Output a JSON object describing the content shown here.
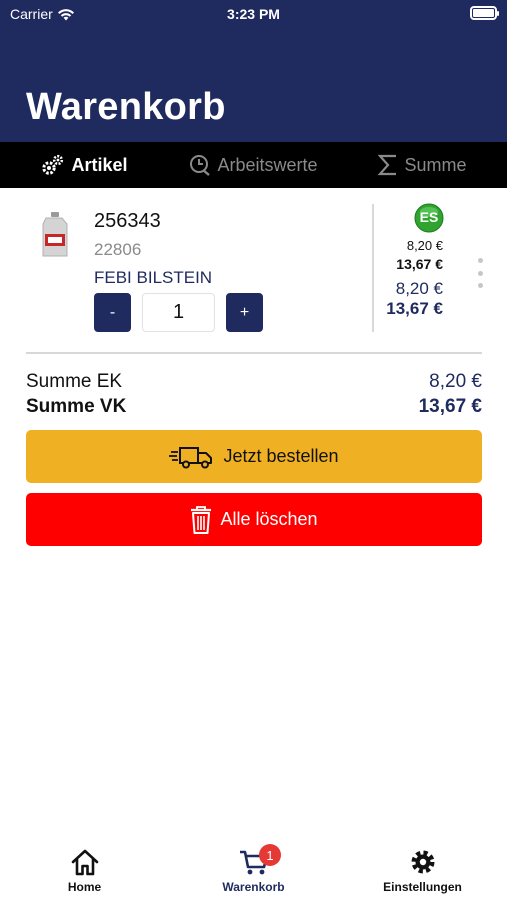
{
  "status_bar": {
    "carrier": "Carrier",
    "time": "3:23 PM"
  },
  "header": {
    "title": "Warenkorb"
  },
  "segments": [
    {
      "label": "Artikel",
      "icon": "gears-icon",
      "active": true
    },
    {
      "label": "Arbeitswerte",
      "icon": "clock-wrench-icon",
      "active": false
    },
    {
      "label": "Summe",
      "icon": "sigma-icon",
      "active": false
    }
  ],
  "cart_item": {
    "article_number": "256343",
    "sub_number": "22806",
    "brand": "FEBI BILSTEIN",
    "quantity": "1",
    "minus_label": "-",
    "plus_label": "+",
    "badge_label": "ES",
    "price_ek_small": "8,20 €",
    "price_vk_small": "13,67 €",
    "price_ek": "8,20 €",
    "price_vk": "13,67 €"
  },
  "summary": {
    "ek_label": "Summe EK",
    "ek_value": "8,20 €",
    "vk_label": "Summe VK",
    "vk_value": "13,67 €"
  },
  "actions": {
    "order_label": "Jetzt bestellen",
    "delete_label": "Alle löschen"
  },
  "tabbar": {
    "items": [
      {
        "label": "Home",
        "icon": "home-icon"
      },
      {
        "label": "Warenkorb",
        "icon": "cart-icon",
        "badge": "1"
      },
      {
        "label": "Einstellungen",
        "icon": "gear-icon"
      }
    ]
  },
  "colors": {
    "navy": "#1f2a5f",
    "order_button": "#f0b023",
    "delete_button": "#ff0000",
    "badge_red": "#e53935",
    "badge_green": "#2fa52f"
  }
}
